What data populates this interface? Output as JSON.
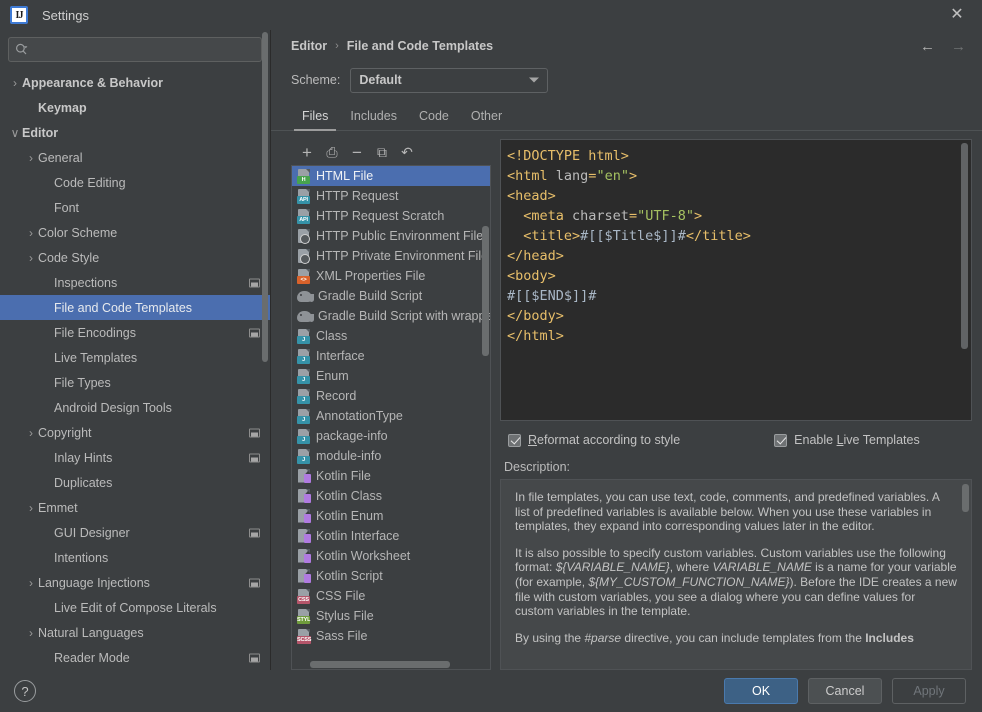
{
  "window": {
    "title": "Settings",
    "logo_text": "IJ",
    "close_icon": "✕"
  },
  "search": {
    "placeholder": "",
    "value": "",
    "icon": "search-icon"
  },
  "sidebar": {
    "items": [
      {
        "label": "Appearance & Behavior",
        "twisty": "›",
        "indent": 0,
        "bold": true,
        "selected": false,
        "badge": false
      },
      {
        "label": "Keymap",
        "twisty": "",
        "indent": 1,
        "bold": true,
        "selected": false,
        "badge": false
      },
      {
        "label": "Editor",
        "twisty": "∨",
        "indent": 0,
        "bold": true,
        "selected": false,
        "badge": false
      },
      {
        "label": "General",
        "twisty": "›",
        "indent": 1,
        "bold": false,
        "selected": false,
        "badge": false
      },
      {
        "label": "Code Editing",
        "twisty": "",
        "indent": 2,
        "bold": false,
        "selected": false,
        "badge": false
      },
      {
        "label": "Font",
        "twisty": "",
        "indent": 2,
        "bold": false,
        "selected": false,
        "badge": false
      },
      {
        "label": "Color Scheme",
        "twisty": "›",
        "indent": 1,
        "bold": false,
        "selected": false,
        "badge": false
      },
      {
        "label": "Code Style",
        "twisty": "›",
        "indent": 1,
        "bold": false,
        "selected": false,
        "badge": false
      },
      {
        "label": "Inspections",
        "twisty": "",
        "indent": 2,
        "bold": false,
        "selected": false,
        "badge": true
      },
      {
        "label": "File and Code Templates",
        "twisty": "",
        "indent": 2,
        "bold": false,
        "selected": true,
        "badge": false
      },
      {
        "label": "File Encodings",
        "twisty": "",
        "indent": 2,
        "bold": false,
        "selected": false,
        "badge": true
      },
      {
        "label": "Live Templates",
        "twisty": "",
        "indent": 2,
        "bold": false,
        "selected": false,
        "badge": false
      },
      {
        "label": "File Types",
        "twisty": "",
        "indent": 2,
        "bold": false,
        "selected": false,
        "badge": false
      },
      {
        "label": "Android Design Tools",
        "twisty": "",
        "indent": 2,
        "bold": false,
        "selected": false,
        "badge": false
      },
      {
        "label": "Copyright",
        "twisty": "›",
        "indent": 1,
        "bold": false,
        "selected": false,
        "badge": true
      },
      {
        "label": "Inlay Hints",
        "twisty": "",
        "indent": 2,
        "bold": false,
        "selected": false,
        "badge": true
      },
      {
        "label": "Duplicates",
        "twisty": "",
        "indent": 2,
        "bold": false,
        "selected": false,
        "badge": false
      },
      {
        "label": "Emmet",
        "twisty": "›",
        "indent": 1,
        "bold": false,
        "selected": false,
        "badge": false
      },
      {
        "label": "GUI Designer",
        "twisty": "",
        "indent": 2,
        "bold": false,
        "selected": false,
        "badge": true
      },
      {
        "label": "Intentions",
        "twisty": "",
        "indent": 2,
        "bold": false,
        "selected": false,
        "badge": false
      },
      {
        "label": "Language Injections",
        "twisty": "›",
        "indent": 1,
        "bold": false,
        "selected": false,
        "badge": true
      },
      {
        "label": "Live Edit of Compose Literals",
        "twisty": "",
        "indent": 2,
        "bold": false,
        "selected": false,
        "badge": false
      },
      {
        "label": "Natural Languages",
        "twisty": "›",
        "indent": 1,
        "bold": false,
        "selected": false,
        "badge": false
      },
      {
        "label": "Reader Mode",
        "twisty": "",
        "indent": 2,
        "bold": false,
        "selected": false,
        "badge": true
      }
    ]
  },
  "header": {
    "breadcrumb": [
      "Editor",
      "File and Code Templates"
    ],
    "breadcrumb_separator": "›",
    "back_arrow": "←",
    "forward_arrow": "→"
  },
  "scheme": {
    "label": "Scheme:",
    "value": "Default"
  },
  "tabs": [
    {
      "label": "Files",
      "active": true
    },
    {
      "label": "Includes",
      "active": false
    },
    {
      "label": "Code",
      "active": false
    },
    {
      "label": "Other",
      "active": false
    }
  ],
  "list_toolbar": [
    {
      "name": "add-template-button",
      "glyph": "+"
    },
    {
      "name": "create-template-from-file-button",
      "glyph": "⎙"
    },
    {
      "name": "remove-template-button",
      "glyph": "−"
    },
    {
      "name": "copy-template-button",
      "glyph": "⧉"
    },
    {
      "name": "reset-template-button",
      "glyph": "↶"
    }
  ],
  "templates": [
    {
      "label": "HTML File",
      "icon": "html-file-icon",
      "kind": "tag",
      "tag": "H",
      "color": "#47a34d",
      "selected": true
    },
    {
      "label": "HTTP Request",
      "icon": "http-request-icon",
      "kind": "tag",
      "tag": "API",
      "color": "#3592a8",
      "selected": false
    },
    {
      "label": "HTTP Request Scratch",
      "icon": "http-request-scratch-icon",
      "kind": "tag",
      "tag": "API",
      "color": "#3592a8",
      "selected": false
    },
    {
      "label": "HTTP Public Environment File",
      "icon": "http-public-env-icon",
      "kind": "globe",
      "tag": "",
      "color": "",
      "selected": false
    },
    {
      "label": "HTTP Private Environment File",
      "icon": "http-private-env-icon",
      "kind": "globe",
      "tag": "",
      "color": "",
      "selected": false
    },
    {
      "label": "XML Properties File",
      "icon": "xml-properties-icon",
      "kind": "tag",
      "tag": "<>",
      "color": "#d9622b",
      "selected": false
    },
    {
      "label": "Gradle Build Script",
      "icon": "gradle-icon",
      "kind": "elephant",
      "tag": "",
      "color": "",
      "selected": false
    },
    {
      "label": "Gradle Build Script with wrapper",
      "icon": "gradle-wrapper-icon",
      "kind": "elephant",
      "tag": "",
      "color": "",
      "selected": false
    },
    {
      "label": "Class",
      "icon": "java-class-icon",
      "kind": "tag",
      "tag": "J",
      "color": "#3592a8",
      "selected": false
    },
    {
      "label": "Interface",
      "icon": "java-interface-icon",
      "kind": "tag",
      "tag": "J",
      "color": "#3592a8",
      "selected": false
    },
    {
      "label": "Enum",
      "icon": "java-enum-icon",
      "kind": "tag",
      "tag": "J",
      "color": "#3592a8",
      "selected": false
    },
    {
      "label": "Record",
      "icon": "java-record-icon",
      "kind": "tag",
      "tag": "J",
      "color": "#3592a8",
      "selected": false
    },
    {
      "label": "AnnotationType",
      "icon": "java-annotation-icon",
      "kind": "tag",
      "tag": "J",
      "color": "#3592a8",
      "selected": false
    },
    {
      "label": "package-info",
      "icon": "java-package-info-icon",
      "kind": "tag",
      "tag": "J",
      "color": "#3592a8",
      "selected": false
    },
    {
      "label": "module-info",
      "icon": "java-module-info-icon",
      "kind": "tag",
      "tag": "J",
      "color": "#3592a8",
      "selected": false
    },
    {
      "label": "Kotlin File",
      "icon": "kotlin-file-icon",
      "kind": "kotlin",
      "tag": "",
      "color": "#b07be0",
      "selected": false
    },
    {
      "label": "Kotlin Class",
      "icon": "kotlin-class-icon",
      "kind": "kotlin",
      "tag": "",
      "color": "#b07be0",
      "selected": false
    },
    {
      "label": "Kotlin Enum",
      "icon": "kotlin-enum-icon",
      "kind": "kotlin",
      "tag": "",
      "color": "#b07be0",
      "selected": false
    },
    {
      "label": "Kotlin Interface",
      "icon": "kotlin-interface-icon",
      "kind": "kotlin",
      "tag": "",
      "color": "#b07be0",
      "selected": false
    },
    {
      "label": "Kotlin Worksheet",
      "icon": "kotlin-worksheet-icon",
      "kind": "kotlin",
      "tag": "",
      "color": "#b07be0",
      "selected": false
    },
    {
      "label": "Kotlin Script",
      "icon": "kotlin-script-icon",
      "kind": "kotlin",
      "tag": "",
      "color": "#b07be0",
      "selected": false
    },
    {
      "label": "CSS File",
      "icon": "css-file-icon",
      "kind": "tag",
      "tag": "CSS",
      "color": "#b5556a",
      "selected": false
    },
    {
      "label": "Stylus File",
      "icon": "stylus-file-icon",
      "kind": "tag",
      "tag": "STYL",
      "color": "#6f9c3c",
      "selected": false
    },
    {
      "label": "Sass File",
      "icon": "sass-file-icon",
      "kind": "tag",
      "tag": "SCSS",
      "color": "#b5556a",
      "selected": false
    }
  ],
  "editor": {
    "lines": [
      [
        {
          "t": "<!DOCTYPE html>",
          "c": "tkp"
        }
      ],
      [
        {
          "t": "<html ",
          "c": "tkp"
        },
        {
          "t": "lang",
          "c": "tka"
        },
        {
          "t": "=",
          "c": "tkp"
        },
        {
          "t": "\"en\"",
          "c": "tkv"
        },
        {
          "t": ">",
          "c": "tkp"
        }
      ],
      [
        {
          "t": "<head>",
          "c": "tkp"
        }
      ],
      [
        {
          "t": "  <meta ",
          "c": "tkp"
        },
        {
          "t": "charset",
          "c": "tka"
        },
        {
          "t": "=",
          "c": "tkp"
        },
        {
          "t": "\"UTF-8\"",
          "c": "tkv"
        },
        {
          "t": ">",
          "c": "tkp"
        }
      ],
      [
        {
          "t": "  <title>",
          "c": "tkp"
        },
        {
          "t": "#[[$Title$]]#",
          "c": "tkt"
        },
        {
          "t": "</title>",
          "c": "tkp"
        }
      ],
      [
        {
          "t": "</head>",
          "c": "tkp"
        }
      ],
      [
        {
          "t": "<body>",
          "c": "tkp"
        }
      ],
      [
        {
          "t": "#[[$END$]]#",
          "c": "tkt"
        }
      ],
      [
        {
          "t": "</body>",
          "c": "tkp"
        }
      ],
      [
        {
          "t": "</html>",
          "c": "tkp"
        }
      ]
    ]
  },
  "options": {
    "reformat": {
      "label_before": "",
      "mnemonic": "R",
      "label_after": "eformat according to style",
      "checked": true
    },
    "live_templates": {
      "label_before": "Enable ",
      "mnemonic": "L",
      "label_after": "ive Templates",
      "checked": true
    }
  },
  "description": {
    "label": "Description:",
    "paragraphs": [
      "In file templates, you can use text, code, comments, and predefined variables. A list of predefined variables is available below. When you use these variables in templates, they expand into corresponding values later in the editor.",
      "It is also possible to specify custom variables. Custom variables use the following format: ${VARIABLE_NAME}, where VARIABLE_NAME is a name for your variable (for example, ${MY_CUSTOM_FUNCTION_NAME}). Before the IDE creates a new file with custom variables, you see a dialog where you can define values for custom variables in the template.",
      "By using the #parse directive, you can include templates from the Includes"
    ]
  },
  "footer": {
    "help_glyph": "?",
    "ok": "OK",
    "cancel": "Cancel",
    "apply": "Apply"
  },
  "colors": {
    "selection_blue": "#4b6eaf",
    "window_bg": "#3c3f41",
    "editor_bg": "#2b2b2b",
    "primary_button": "#3d6185"
  }
}
